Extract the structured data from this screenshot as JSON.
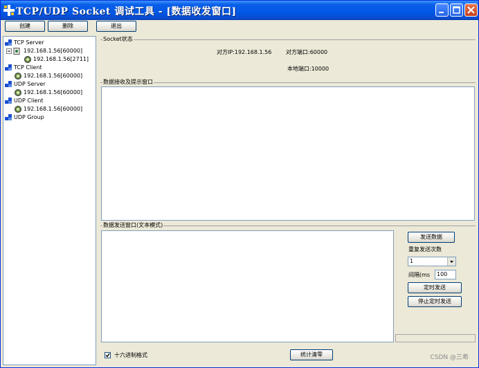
{
  "window": {
    "title": "TCP/UDP Socket 调试工具 - [数据收发窗口]"
  },
  "toolbar": {
    "create_label": "创建",
    "delete_label": "删除",
    "exit_label": "退出"
  },
  "tree": {
    "tcp_server": "TCP Server",
    "tcp_server_item": "192.168.1.56[60000]",
    "tcp_server_child": "192.168.1.56[2711]",
    "tcp_client": "TCP Client",
    "tcp_client_item": "192.168.1.56[60000]",
    "udp_server": "UDP Server",
    "udp_server_item": "192.168.1.56[60000]",
    "udp_client": "UDP Client",
    "udp_client_item": "192.168.1.56[60000]",
    "udp_group": "UDP Group"
  },
  "socket_status": {
    "label": "Socket状态",
    "remote_ip": "对方IP:192.168.1.56",
    "remote_port": "对方端口:60000",
    "local_port": "本地端口:10000"
  },
  "receive": {
    "label": "数据接收及提示窗口"
  },
  "send": {
    "label": "数据发送窗口(文本模式)",
    "send_button": "发送数据",
    "repeat_label": "重复发送次数",
    "repeat_value": "1",
    "interval_label": "间隔(ms",
    "interval_value": "100",
    "timed_send_button": "定时发送",
    "stop_timed_button": "停止定时发送"
  },
  "bottom": {
    "hex_label": "十六进制格式",
    "clear_stats_button": "统计清零"
  },
  "watermark": "CSDN @三希"
}
